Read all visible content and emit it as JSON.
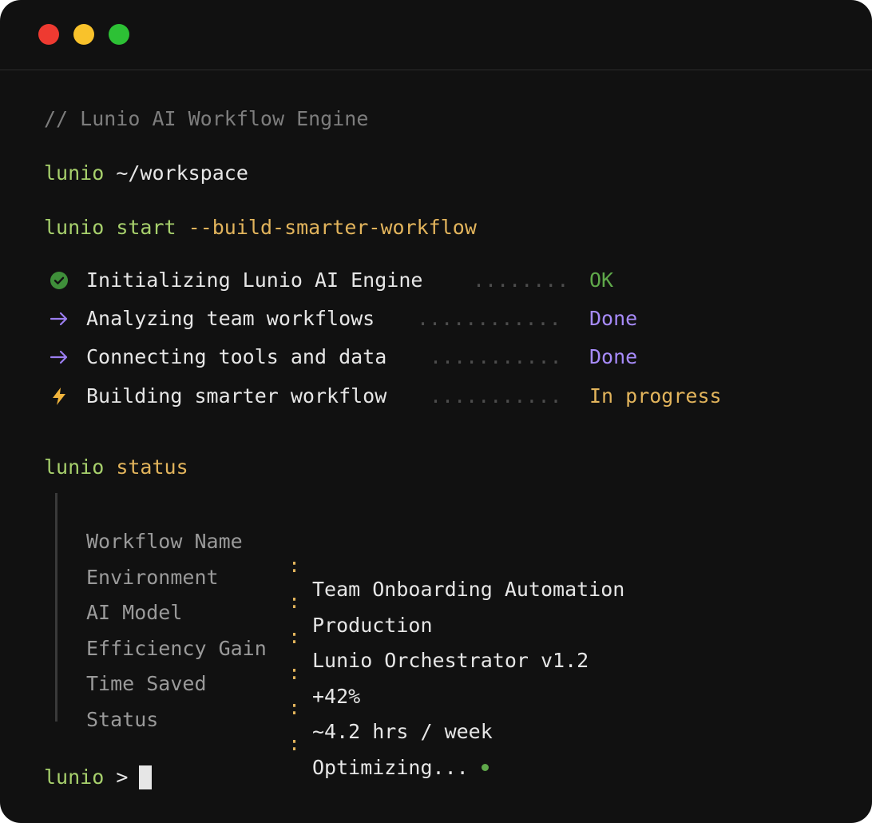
{
  "window": {
    "controls": [
      "close",
      "minimize",
      "maximize"
    ],
    "colors": {
      "close": "#ee3a31",
      "minimize": "#f9c22b",
      "maximize": "#2dc135"
    }
  },
  "terminal": {
    "comment": "// Lunio AI Workflow Engine",
    "prompt_cwd": {
      "prompt": "lunio",
      "path": "~/workspace"
    },
    "command": {
      "prompt": "lunio",
      "cmd": "start",
      "flag": "--build-smarter-workflow"
    },
    "steps": [
      {
        "icon": "check-circle-icon",
        "label": "Initializing Lunio AI Engine",
        "leader": "........",
        "result": "OK",
        "result_color": "#5fa84a"
      },
      {
        "icon": "arrow-right-icon",
        "label": "Analyzing team workflows",
        "leader": "............",
        "result": "Done",
        "result_color": "#a78bfa"
      },
      {
        "icon": "arrow-right-icon",
        "label": "Connecting tools and data",
        "leader": "...........",
        "result": "Done",
        "result_color": "#a78bfa"
      },
      {
        "icon": "lightning-icon",
        "label": "Building smarter workflow",
        "leader": "...........",
        "result": "In progress",
        "result_color": "#e2b45c"
      }
    ],
    "status_command": {
      "prompt": "lunio",
      "cmd": "status"
    },
    "status": [
      {
        "key": "Workflow Name",
        "value": "Team Onboarding Automation"
      },
      {
        "key": "Environment",
        "value": "Production"
      },
      {
        "key": "AI Model",
        "value": "Lunio Orchestrator v1.2"
      },
      {
        "key": "Efficiency Gain",
        "value": "+42%"
      },
      {
        "key": "Time Saved",
        "value": "~4.2 hrs / week"
      },
      {
        "key": "Status",
        "value": "Optimizing..."
      }
    ],
    "separator": ":",
    "input_prompt": {
      "prompt": "lunio",
      "symbol": ">"
    }
  }
}
